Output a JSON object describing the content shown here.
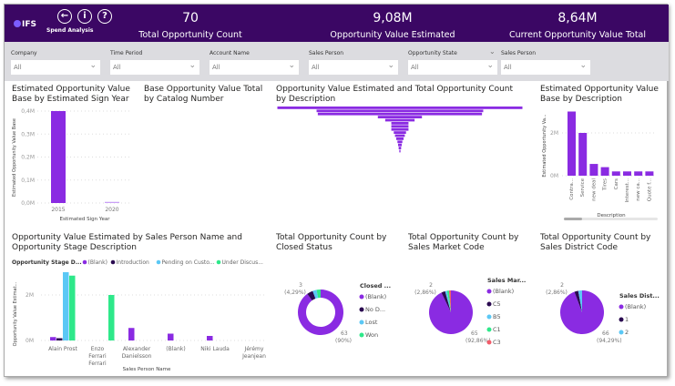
{
  "header": {
    "logo": "IFS",
    "app_name": "Spend Analysis",
    "icons": [
      "back-arrow-icon",
      "info-icon",
      "help-icon"
    ],
    "kpis": [
      {
        "value": "70",
        "label": "Total Opportunity Count"
      },
      {
        "value": "9,08M",
        "label": "Opportunity Value Estimated"
      },
      {
        "value": "8,64M",
        "label": "Current Opportunity Value Total"
      }
    ]
  },
  "filters": [
    {
      "label": "Company",
      "value": "All"
    },
    {
      "label": "Time Period",
      "value": "All"
    },
    {
      "label": "Account Name",
      "value": "All"
    },
    {
      "label": "Sales Person",
      "value": "All"
    },
    {
      "label": "Opportunity State",
      "value": "All"
    },
    {
      "label": "Sales Person",
      "value": "All"
    }
  ],
  "colors": {
    "header": "#3b0764",
    "blank": "#8a2be2",
    "dark": "#2a0a50",
    "lightblue": "#5bc8f5",
    "green": "#2ee88a",
    "red": "#f25c6a"
  },
  "chart_data": [
    {
      "id": "sign-year",
      "type": "bar",
      "title": "Estimated Opportunity Value Base by Estimated Sign Year",
      "xlabel": "Estimated Sign Year",
      "ylabel": "Estimated Opportunity Value Base",
      "categories": [
        "2015",
        "2020"
      ],
      "values": [
        0.4,
        0.005
      ],
      "yticks": [
        "0,0M",
        "0,1M",
        "0,2M",
        "0,3M",
        "0,4M"
      ],
      "ylim": [
        0,
        0.4
      ],
      "unit": "M"
    },
    {
      "id": "catalog",
      "type": "bar",
      "title": "Base Opportunity Value Total by Catalog Number"
    },
    {
      "id": "funnel",
      "type": "funnel",
      "title": "Opportunity Value Estimated and Total Opportunity Count by Description",
      "values": [
        100,
        68,
        67,
        18,
        12,
        7,
        7,
        7,
        5,
        4,
        3,
        2,
        1.5,
        1,
        0.5
      ]
    },
    {
      "id": "by-description",
      "type": "bar",
      "title": "Estimated Opportunity Value Base by Description",
      "xlabel": "Description",
      "ylabel": "Estimated Opportunity Va...",
      "categories": [
        "Contra...",
        "Service",
        "new deal",
        "Tires",
        "Cars",
        "Interest...",
        "new ca...",
        "Quote f..."
      ],
      "values": [
        3.0,
        2.0,
        0.55,
        0.4,
        0.2,
        0.2,
        0.2,
        0.2
      ],
      "yticks": [
        "0M",
        "2M"
      ],
      "ylim": [
        0,
        3.2
      ],
      "unit": "M"
    },
    {
      "id": "by-salesperson",
      "type": "bar",
      "title": "Opportunity Value Estimated by Sales Person Name and Opportunity Stage Description",
      "legend_title": "Opportunity Stage D...",
      "xlabel": "Sales Person Name",
      "ylabel": "Opportunity Value Estimat...",
      "categories": [
        "Alain Prost",
        "Enzo Ferrari",
        "Alexander Danielsson",
        "(Blank)",
        "Niki Lauda",
        "Jérémy Jeanjean"
      ],
      "series": [
        {
          "name": "(Blank)",
          "color": "#8a2be2",
          "values": [
            0.15,
            0,
            0.55,
            0.3,
            0.2,
            0
          ]
        },
        {
          "name": "Introduction",
          "color": "#2a0a50",
          "values": [
            0.1,
            0,
            0,
            0,
            0,
            0
          ]
        },
        {
          "name": "Pending on Custo...",
          "color": "#5bc8f5",
          "values": [
            3.0,
            0,
            0,
            0,
            0,
            0
          ]
        },
        {
          "name": "Under Discus...",
          "color": "#2ee88a",
          "values": [
            2.85,
            2.0,
            0,
            0,
            0,
            0
          ]
        }
      ],
      "yticks": [
        "0M",
        "2M"
      ],
      "ylim": [
        0,
        3.2
      ],
      "unit": "M",
      "legend": "top"
    },
    {
      "id": "closed-status",
      "type": "donut",
      "title": "Total Opportunity Count by Closed Status",
      "legend_title": "Closed ...",
      "slices": [
        {
          "name": "(Blank)",
          "value": 63,
          "color": "#8a2be2"
        },
        {
          "name": "No D...",
          "value": 3,
          "color": "#2a0a50"
        },
        {
          "name": "Lost",
          "value": 2,
          "color": "#5bc8f5"
        },
        {
          "name": "Won",
          "value": 2,
          "color": "#2ee88a"
        }
      ],
      "labels": [
        {
          "value": "3",
          "pct": "(4,29%)"
        },
        {
          "value": "63",
          "pct": "(90%)"
        }
      ]
    },
    {
      "id": "market-code",
      "type": "pie",
      "title": "Total Opportunity Count by Sales Market Code",
      "legend_title": "Sales Mar...",
      "slices": [
        {
          "name": "(Blank)",
          "value": 65,
          "color": "#8a2be2"
        },
        {
          "name": "C5",
          "value": 2,
          "color": "#2a0a50"
        },
        {
          "name": "B5",
          "value": 1,
          "color": "#5bc8f5"
        },
        {
          "name": "C1",
          "value": 1,
          "color": "#2ee88a"
        },
        {
          "name": "C3",
          "value": 1,
          "color": "#f25c6a"
        }
      ],
      "labels": [
        {
          "value": "2",
          "pct": "(2,86%)"
        },
        {
          "value": "65",
          "pct": "(92,86%)"
        }
      ]
    },
    {
      "id": "district-code",
      "type": "pie",
      "title": "Total Opportunity Count by Sales District Code",
      "legend_title": "Sales Dist...",
      "slices": [
        {
          "name": "(Blank)",
          "value": 66,
          "color": "#8a2be2"
        },
        {
          "name": "1",
          "value": 2,
          "color": "#2a0a50"
        },
        {
          "name": "2",
          "value": 2,
          "color": "#5bc8f5"
        }
      ],
      "labels": [
        {
          "value": "2",
          "pct": "(2,86%)"
        },
        {
          "value": "66",
          "pct": "(94,29%)"
        }
      ]
    }
  ]
}
